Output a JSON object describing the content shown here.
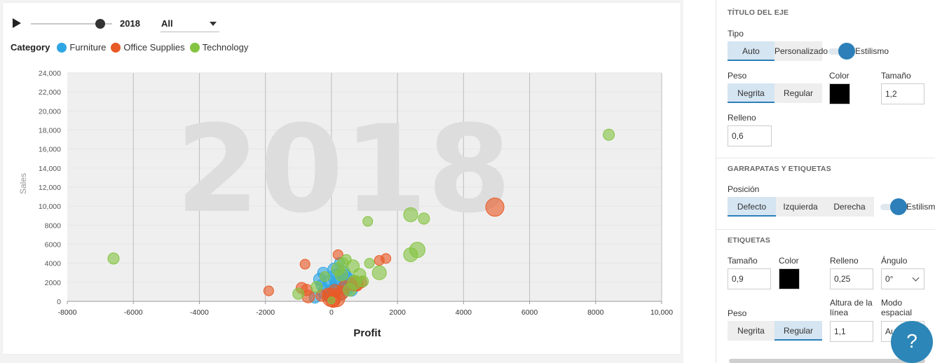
{
  "timeline": {
    "year": "2018",
    "filter_value": "All",
    "progress": 0.85
  },
  "legend": {
    "title": "Category",
    "items": [
      {
        "label": "Furniture",
        "color": "#2ea6e4"
      },
      {
        "label": "Office Supplies",
        "color": "#e85a26"
      },
      {
        "label": "Technology",
        "color": "#85c442"
      }
    ]
  },
  "chart_data": {
    "type": "scatter",
    "watermark": "2018",
    "xlabel": "Profit",
    "ylabel": "Sales",
    "xlim": [
      -8000,
      10000
    ],
    "ylim": [
      0,
      24000
    ],
    "x_ticks": [
      "-8000",
      "-6000",
      "-4000",
      "-2000",
      "0",
      "2000",
      "4000",
      "6000",
      "8000",
      "10,000"
    ],
    "y_ticks": [
      "0",
      "2000",
      "4000",
      "6000",
      "8000",
      "10,000",
      "12,000",
      "14,000",
      "16,000",
      "18,000",
      "20,000",
      "22,000",
      "24,000"
    ],
    "grid": "vertical",
    "series": [
      {
        "name": "Furniture",
        "color": "#2ea6e4",
        "points": [
          [
            -350,
            2300,
            9
          ],
          [
            -300,
            1700,
            8
          ],
          [
            -200,
            1000,
            10
          ],
          [
            -100,
            600,
            8
          ],
          [
            50,
            1300,
            9
          ],
          [
            100,
            3300,
            10
          ],
          [
            150,
            2500,
            12
          ],
          [
            200,
            1800,
            11
          ],
          [
            300,
            800,
            9
          ],
          [
            350,
            3000,
            10
          ],
          [
            450,
            1500,
            11
          ],
          [
            500,
            2100,
            12
          ],
          [
            -500,
            400,
            8
          ],
          [
            -250,
            3000,
            8
          ],
          [
            250,
            4100,
            7
          ],
          [
            600,
            1200,
            9
          ],
          [
            400,
            2600,
            10
          ],
          [
            -50,
            2000,
            9
          ]
        ]
      },
      {
        "name": "Office Supplies",
        "color": "#e85a26",
        "points": [
          [
            4950,
            9900,
            13
          ],
          [
            1650,
            4500,
            7
          ],
          [
            1450,
            4300,
            7
          ],
          [
            200,
            4900,
            7
          ],
          [
            -800,
            3900,
            7
          ],
          [
            -1900,
            1100,
            7
          ],
          [
            -900,
            1400,
            8
          ],
          [
            -700,
            500,
            9
          ],
          [
            -750,
            1200,
            8
          ],
          [
            0,
            400,
            13
          ],
          [
            150,
            300,
            12
          ],
          [
            300,
            900,
            10
          ],
          [
            700,
            1900,
            11
          ],
          [
            750,
            1800,
            10
          ],
          [
            -100,
            800,
            8
          ],
          [
            50,
            100,
            10
          ],
          [
            400,
            1500,
            9
          ],
          [
            900,
            2000,
            8
          ],
          [
            -300,
            600,
            8
          ],
          [
            100,
            1100,
            9
          ]
        ]
      },
      {
        "name": "Technology",
        "color": "#85c442",
        "points": [
          [
            8400,
            17500,
            8
          ],
          [
            -6600,
            4500,
            8
          ],
          [
            2600,
            5400,
            11
          ],
          [
            2400,
            4900,
            10
          ],
          [
            2400,
            9100,
            10
          ],
          [
            2800,
            8700,
            8
          ],
          [
            1100,
            8400,
            7
          ],
          [
            1450,
            3000,
            10
          ],
          [
            1150,
            4000,
            7
          ],
          [
            850,
            2800,
            9
          ],
          [
            650,
            3700,
            9
          ],
          [
            450,
            4400,
            7
          ],
          [
            350,
            4000,
            8
          ],
          [
            -1000,
            800,
            8
          ],
          [
            -450,
            1500,
            8
          ],
          [
            0,
            100,
            5
          ],
          [
            700,
            2000,
            10
          ],
          [
            950,
            2100,
            8
          ],
          [
            300,
            2800,
            9
          ],
          [
            550,
            1200,
            9
          ],
          [
            200,
            3400,
            9
          ],
          [
            -200,
            2600,
            7
          ]
        ]
      }
    ]
  },
  "panel": {
    "axis_title": {
      "heading": "TÍTULO DEL EJE",
      "type_label": "Tipo",
      "type_options": [
        "Auto",
        "Personalizado"
      ],
      "type_active": 0,
      "styling_label": "Estilismo",
      "weight_label": "Peso",
      "weight_options": [
        "Negrita",
        "Regular"
      ],
      "weight_active": 0,
      "color_label": "Color",
      "color_value": "#000000",
      "size_label": "Tamaño",
      "size_value": "1,2",
      "padding_label": "Relleno",
      "padding_value": "0,6"
    },
    "ticks": {
      "heading": "GARRAPATAS Y ETIQUETAS",
      "position_label": "Posición",
      "position_options": [
        "Defecto",
        "Izquierda",
        "Derecha"
      ],
      "position_active": 0,
      "styling_label": "Estilismo"
    },
    "labels": {
      "heading": "ETIQUETAS",
      "size_label": "Tamaño",
      "size_value": "0,9",
      "color_label": "Color",
      "color_value": "#000000",
      "padding_label": "Relleno",
      "padding_value": "0,25",
      "angle_label": "Ángulo",
      "angle_value": "0°",
      "weight_label": "Peso",
      "weight_options": [
        "Negrita",
        "Regular"
      ],
      "weight_active": 1,
      "line_height_label_1": "Altura de la",
      "line_height_label_2": "línea",
      "line_height_value": "1,1",
      "spacing_label_1": "Modo",
      "spacing_label_2": "espacial",
      "spacing_value": "Auto"
    },
    "help_label": "?"
  }
}
